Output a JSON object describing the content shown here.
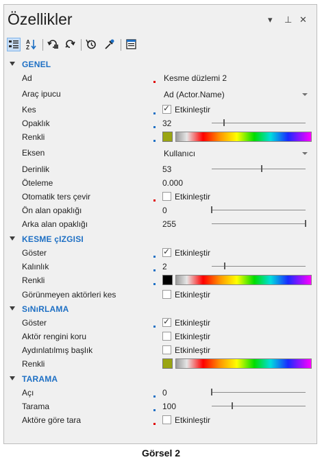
{
  "panel": {
    "title": "Özellikler",
    "window_buttons": {
      "pin": "▾",
      "autohide": "⊥",
      "close": "✕"
    }
  },
  "toolbar": {
    "items": [
      {
        "icon": "categorized-view-icon",
        "active": true
      },
      {
        "icon": "alphabetical-sort-icon",
        "active": false
      },
      {
        "icon": "undo-icon",
        "active": false
      },
      {
        "icon": "redo-icon",
        "active": false
      },
      {
        "icon": "reset-icon",
        "active": false
      },
      {
        "icon": "eyedropper-icon",
        "active": false
      },
      {
        "icon": "property-pages-icon",
        "active": false
      }
    ]
  },
  "sections": {
    "genel": {
      "label": "GENEL",
      "rows": {
        "ad": {
          "name": "Ad",
          "value": "Kesme düzlemi 2"
        },
        "arac_ipucu": {
          "name": "Araç ipucu",
          "value": "Ad (Actor.Name)"
        },
        "kes": {
          "name": "Kes",
          "checkbox_label": "Etkinleştir",
          "checked": true
        },
        "opaklik": {
          "name": "Opaklık",
          "value": "32",
          "slider_fraction": 0.13
        },
        "renkli": {
          "name": "Renkli",
          "swatch_color": "#9aa512"
        },
        "eksen": {
          "name": "Eksen",
          "value": "Kullanıcı"
        },
        "derinlik": {
          "name": "Derinlik",
          "value": "53",
          "slider_fraction": 0.53
        },
        "oteleme": {
          "name": "Öteleme",
          "value": "0.000"
        },
        "otomatik": {
          "name": "Otomatik ters çevir",
          "checkbox_label": "Etkinleştir",
          "checked": false
        },
        "on_alan": {
          "name": "Ön alan opaklığı",
          "value": "0",
          "slider_fraction": 0.0
        },
        "arka_alan": {
          "name": "Arka alan opaklığı",
          "value": "255",
          "slider_fraction": 1.0
        }
      }
    },
    "kesme_cizgisi": {
      "label": "KESME çIZGISI",
      "rows": {
        "goster": {
          "name": "Göster",
          "checkbox_label": "Etkinleştir",
          "checked": true
        },
        "kalinlik": {
          "name": "Kalınlık",
          "value": "2",
          "slider_fraction": 0.14
        },
        "renkli": {
          "name": "Renkli",
          "swatch_color": "#000000"
        },
        "gorunmeyen": {
          "name": "Görünmeyen aktörleri kes",
          "checkbox_label": "Etkinleştir",
          "checked": false
        }
      }
    },
    "sinirlama": {
      "label": "SıNıRLAMA",
      "rows": {
        "goster": {
          "name": "Göster",
          "checkbox_label": "Etkinleştir",
          "checked": true
        },
        "aktor_rengi": {
          "name": "Aktör rengini koru",
          "checkbox_label": "Etkinleştir",
          "checked": false
        },
        "aydinlatilmis": {
          "name": "Aydınlatılmış başlık",
          "checkbox_label": "Etkinleştir",
          "checked": false
        },
        "renkli": {
          "name": "Renkli",
          "swatch_color": "#9aa512"
        }
      }
    },
    "tarama": {
      "label": "TARAMA",
      "rows": {
        "aci": {
          "name": "Açı",
          "value": "0",
          "slider_fraction": 0.0
        },
        "tarama": {
          "name": "Tarama",
          "value": "100",
          "slider_fraction": 0.22
        },
        "aktore_gore": {
          "name": "Aktöre göre tara",
          "checkbox_label": "Etkinleştir",
          "checked": false
        }
      }
    }
  },
  "marker_colors": {
    "required": "#e00000",
    "modified": "#1d6fc4"
  },
  "caption": "Görsel 2"
}
